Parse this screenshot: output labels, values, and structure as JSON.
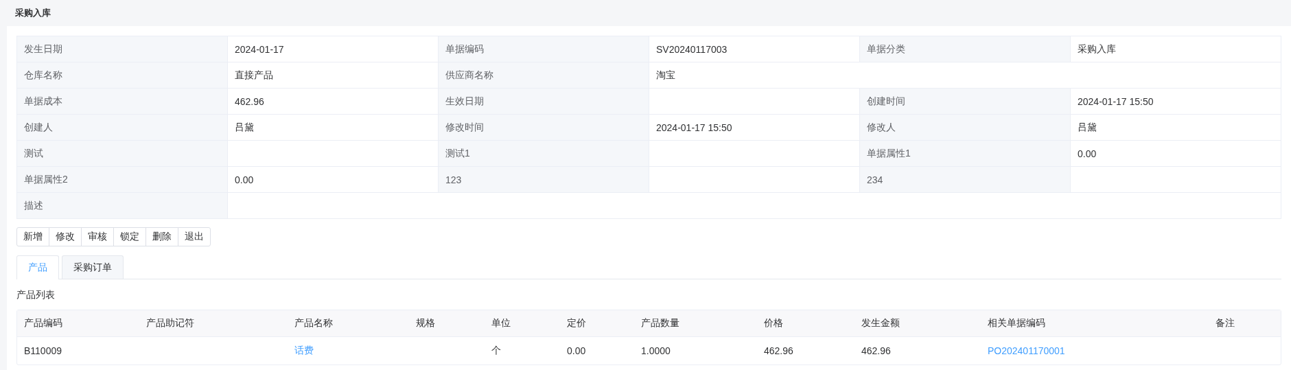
{
  "page_title": "采购入库",
  "details": {
    "rows": [
      [
        {
          "kind": "label",
          "text": "发生日期"
        },
        {
          "kind": "value",
          "text": "2024-01-17"
        },
        {
          "kind": "label",
          "text": "单据编码"
        },
        {
          "kind": "value",
          "text": "SV20240117003"
        },
        {
          "kind": "label",
          "text": "单据分类"
        },
        {
          "kind": "value",
          "text": "采购入库"
        }
      ],
      [
        {
          "kind": "label",
          "text": "仓库名称"
        },
        {
          "kind": "value",
          "text": "直接产品"
        },
        {
          "kind": "label",
          "text": "供应商名称"
        },
        {
          "kind": "value",
          "text": "淘宝"
        }
      ],
      [
        {
          "kind": "label",
          "text": "单据成本"
        },
        {
          "kind": "value",
          "text": "462.96"
        },
        {
          "kind": "label",
          "text": "生效日期"
        },
        {
          "kind": "value"
        },
        {
          "kind": "label",
          "text": "创建时间"
        },
        {
          "kind": "value",
          "text": "2024-01-17 15:50"
        }
      ],
      [
        {
          "kind": "label",
          "text": "创建人"
        },
        {
          "kind": "value",
          "text": "吕黛"
        },
        {
          "kind": "label",
          "text": "修改时间"
        },
        {
          "kind": "value",
          "text": "2024-01-17 15:50"
        },
        {
          "kind": "label",
          "text": "修改人"
        },
        {
          "kind": "value",
          "text": "吕黛"
        }
      ],
      [
        {
          "kind": "label",
          "text": "测试"
        },
        {
          "kind": "value"
        },
        {
          "kind": "label",
          "text": "测试1"
        },
        {
          "kind": "value"
        },
        {
          "kind": "label",
          "text": "单据属性1"
        },
        {
          "kind": "value",
          "text": "0.00"
        }
      ],
      [
        {
          "kind": "label",
          "text": "单据属性2"
        },
        {
          "kind": "value",
          "text": "0.00"
        },
        {
          "kind": "label",
          "text": "123"
        },
        {
          "kind": "value"
        },
        {
          "kind": "label",
          "text": "234"
        },
        {
          "kind": "value"
        }
      ],
      [
        {
          "kind": "label",
          "text": "描述"
        },
        {
          "kind": "value"
        }
      ]
    ]
  },
  "buttons": [
    "新增",
    "修改",
    "审核",
    "锁定",
    "删除",
    "退出"
  ],
  "tabs": [
    {
      "label": "产品",
      "selected": true
    },
    {
      "label": "采购订单",
      "selected": false
    }
  ],
  "section_title": "产品列表",
  "table": {
    "columns": [
      "产品编码",
      "产品助记符",
      "产品名称",
      "规格",
      "单位",
      "定价",
      "产品数量",
      "价格",
      "发生金额",
      "相关单据编码",
      "备注"
    ],
    "rows": [
      [
        {
          "kind": "text",
          "text": "B110009"
        },
        {
          "kind": "text"
        },
        {
          "kind": "link",
          "text": "话费"
        },
        {
          "kind": "text"
        },
        {
          "kind": "text",
          "text": "个"
        },
        {
          "kind": "text",
          "text": "0.00"
        },
        {
          "kind": "text",
          "text": "1.0000"
        },
        {
          "kind": "text",
          "text": "462.96"
        },
        {
          "kind": "text",
          "text": "462.96"
        },
        {
          "kind": "link",
          "text": "PO202401170001"
        },
        {
          "kind": "text"
        }
      ]
    ]
  }
}
